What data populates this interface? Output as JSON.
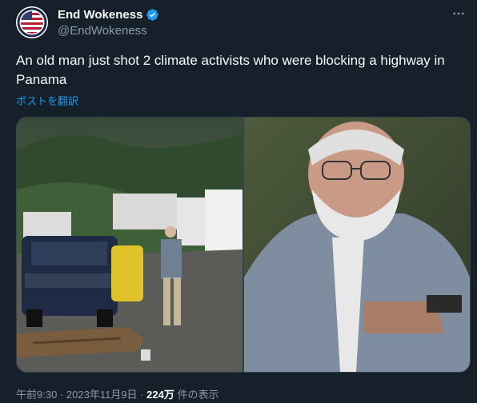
{
  "author": {
    "display_name": "End Wokeness",
    "handle": "@EndWokeness",
    "verified": true,
    "verified_color": "#1d9bf0"
  },
  "tweet": {
    "text": "An old man just shot 2 climate activists who were blocking a highway in Panama",
    "translate_label": "ポストを翻訳",
    "more_icon": "more-icon"
  },
  "media": [
    {
      "name": "highway-photo"
    },
    {
      "name": "closeup-photo"
    }
  ],
  "meta": {
    "time": "午前9:30",
    "sep": "·",
    "date": "2023年11月9日",
    "views_count": "224万",
    "views_label": "件の表示"
  }
}
